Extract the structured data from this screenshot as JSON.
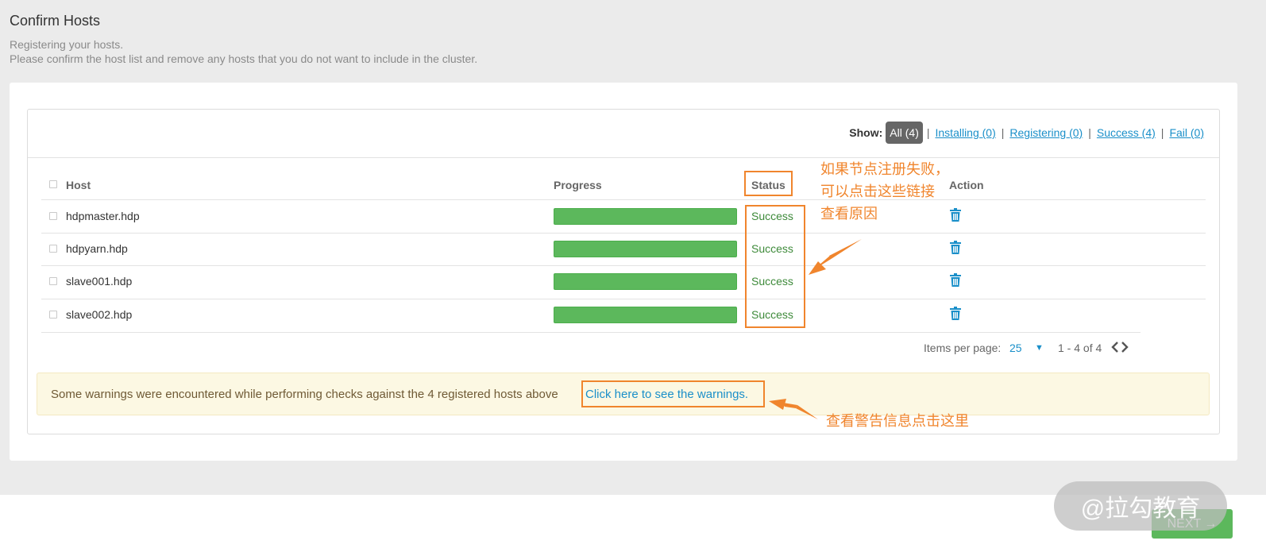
{
  "header": {
    "title": "Confirm Hosts",
    "subtitle_line1": "Registering your hosts.",
    "subtitle_line2": "Please confirm the host list and remove any hosts that you do not want to include in the cluster."
  },
  "filter": {
    "show_label": "Show:",
    "all": "All (4)",
    "installing": "Installing (0)",
    "registering": "Registering (0)",
    "success": "Success (4)",
    "fail": "Fail (0)",
    "separator": "|"
  },
  "table": {
    "columns": {
      "host": "Host",
      "progress": "Progress",
      "status": "Status",
      "action": "Action"
    },
    "rows": [
      {
        "host": "hdpmaster.hdp",
        "progress": 1.0,
        "status": "Success"
      },
      {
        "host": "hdpyarn.hdp",
        "progress": 1.0,
        "status": "Success"
      },
      {
        "host": "slave001.hdp",
        "progress": 1.0,
        "status": "Success"
      },
      {
        "host": "slave002.hdp",
        "progress": 1.0,
        "status": "Success"
      }
    ]
  },
  "pagination": {
    "items_label": "Items per page:",
    "items_value": "25",
    "range": "1 - 4 of 4"
  },
  "alert": {
    "text": "Some warnings were encountered while performing checks against the 4 registered hosts above",
    "link": "Click here to see the warnings."
  },
  "annotations": {
    "status_note_line1": "如果节点注册失败，",
    "status_note_line2": "可以点击这些链接",
    "status_note_line3": "查看原因",
    "warning_note": "查看警告信息点击这里"
  },
  "footer": {
    "next_label": "NEXT →",
    "watermark": "@拉勾教育"
  },
  "colors": {
    "accent_link": "#1a8fc9",
    "progress_green": "#5cb85c",
    "status_green": "#3e8a3a",
    "annotation_orange": "#f0852d",
    "alert_bg": "#fcf8e3"
  }
}
